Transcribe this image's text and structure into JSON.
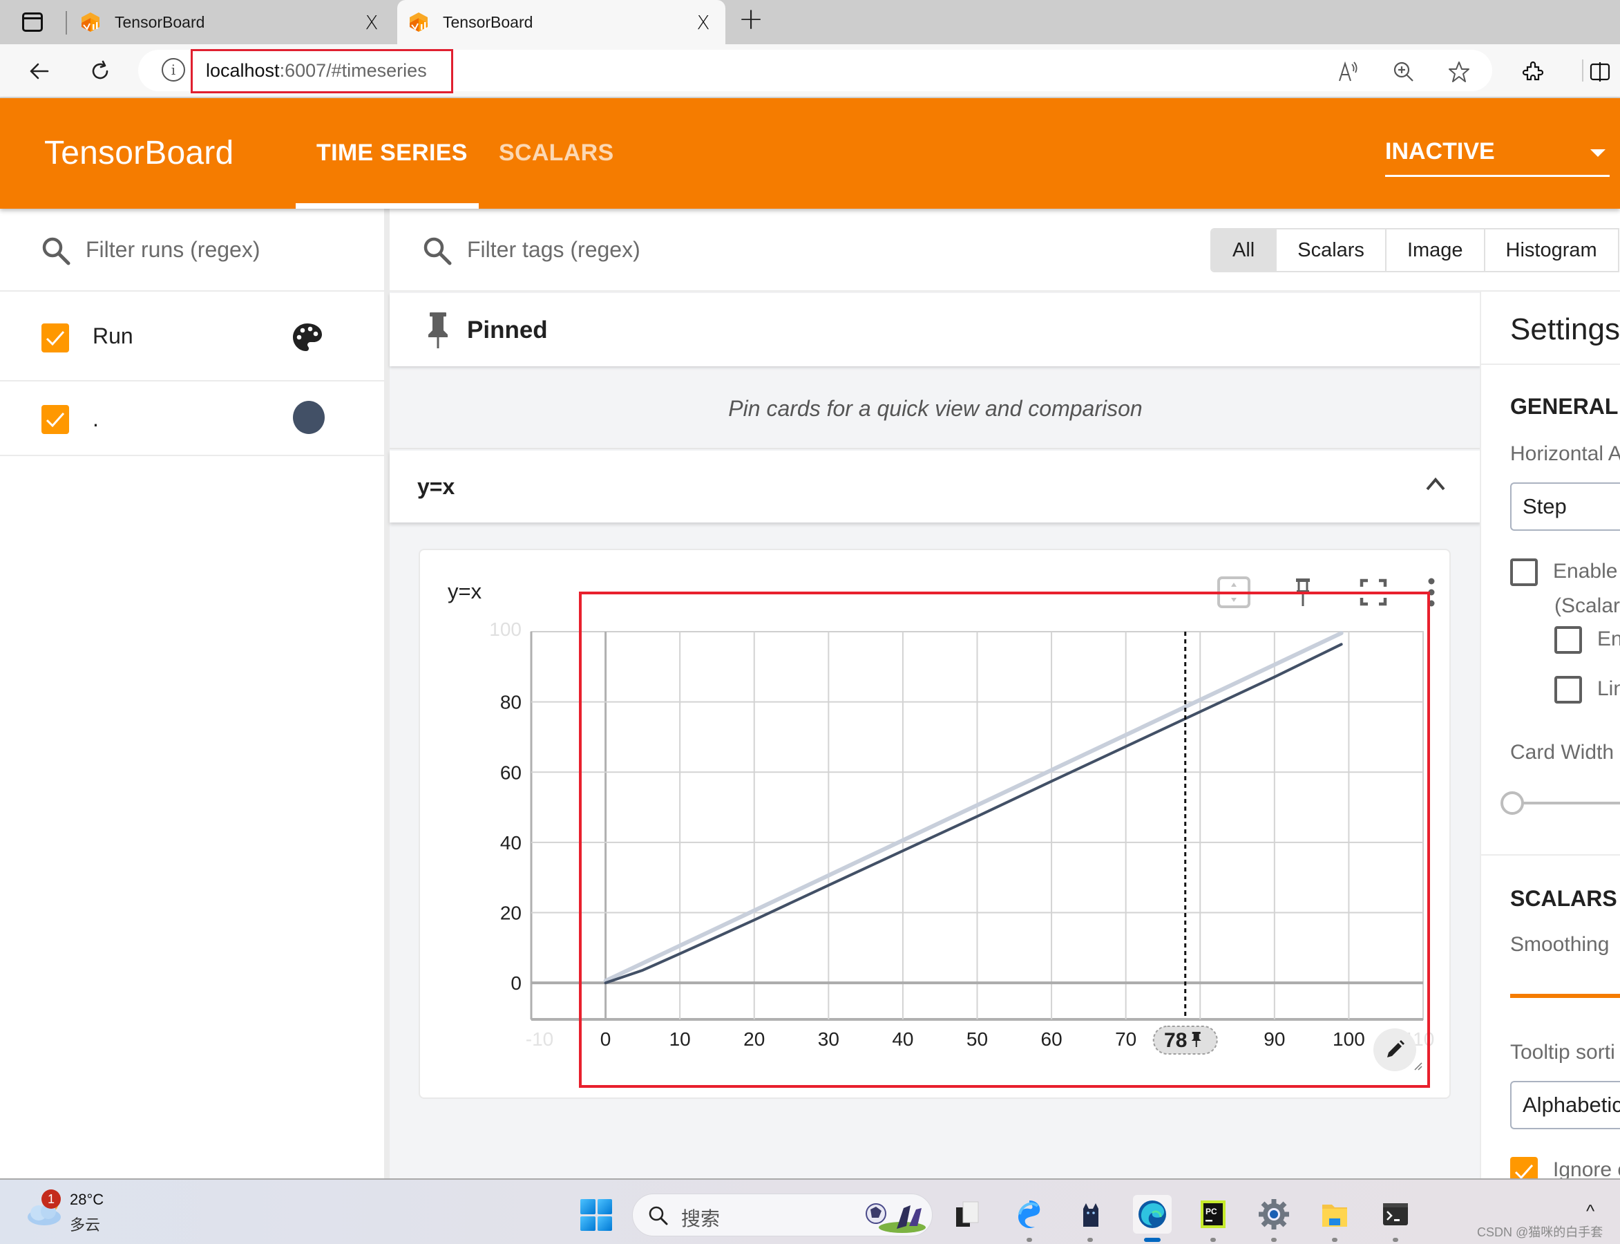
{
  "browser": {
    "tabs": [
      {
        "title": "TensorBoard",
        "active": false,
        "icon": "tensorboard-favicon"
      },
      {
        "title": "TensorBoard",
        "active": true,
        "icon": "tensorboard-favicon"
      }
    ],
    "tab_close_glyph": "X",
    "new_tab_glyph": "+",
    "url_host": "localhost",
    "url_rest": ":6007/#timeseries",
    "toolbar_icons": [
      "read-aloud-icon",
      "zoom-icon",
      "favorite-star-icon",
      "extensions-icon",
      "split-screen-icon"
    ]
  },
  "header": {
    "logo": "TensorBoard",
    "tabs": [
      {
        "label": "TIME SERIES",
        "active": true
      },
      {
        "label": "SCALARS",
        "active": false
      }
    ],
    "status_select": "INACTIVE",
    "colors": {
      "brand": "#f57c00",
      "checkbox": "#ff9800",
      "run_color": "#425066",
      "smoothed_raw": "#c8cfdb"
    }
  },
  "runs": {
    "filter_placeholder": "Filter runs (regex)",
    "header_row": {
      "label": "Run",
      "checked": true
    },
    "items": [
      {
        "label": ".",
        "checked": true,
        "color": "#425066"
      }
    ]
  },
  "main": {
    "tag_filter_placeholder": "Filter tags (regex)",
    "type_filters": [
      "All",
      "Scalars",
      "Image",
      "Histogram"
    ],
    "type_filter_selected": "All",
    "pinned_title": "Pinned",
    "pinned_empty": "Pin cards for a quick view and comparison",
    "group_title": "y=x",
    "card": {
      "title": "y=x",
      "toolbar": [
        "fit-domain-icon",
        "pin-icon",
        "fullscreen-icon",
        "more-vert-icon"
      ],
      "pinned_step_label": "78"
    }
  },
  "chart_data": {
    "type": "line",
    "title": "y=x",
    "xlabel": "",
    "ylabel": "",
    "xlim": [
      -10,
      110
    ],
    "ylim": [
      -10.4,
      100
    ],
    "x_ticks": [
      0,
      10,
      20,
      30,
      40,
      50,
      60,
      70,
      90,
      100
    ],
    "x_ticks_faded": [
      -10,
      110
    ],
    "y_ticks": [
      0,
      20,
      40,
      60,
      80
    ],
    "y_ticks_faded": [
      100
    ],
    "grid": true,
    "legend": "none",
    "pinned_step": 78,
    "series": [
      {
        "name": ". (raw)",
        "color": "#c8cfdb",
        "x": [
          0,
          99
        ],
        "y": [
          0,
          99
        ]
      },
      {
        "name": ". (smoothed)",
        "color": "#425066",
        "x": [
          0,
          5,
          10,
          20,
          30,
          40,
          50,
          60,
          70,
          80,
          90,
          99
        ],
        "y": [
          0,
          3.6,
          8.3,
          17.9,
          27.8,
          37.6,
          47.4,
          57.4,
          67.3,
          77.2,
          87.1,
          96.4
        ]
      }
    ]
  },
  "settings": {
    "title": "Settings",
    "general_heading": "GENERAL",
    "horizontal_axis_label": "Horizontal A",
    "horizontal_axis_value": "Step",
    "enable_step_selection_label": "Enable s",
    "enable_step_selection_sub": "(Scalars",
    "enable_range_label": "Ena",
    "link_label": "Lin",
    "enable_checked": false,
    "card_width_label": "Card Width",
    "card_width_value": 0,
    "scalars_heading": "SCALARS",
    "smoothing_label": "Smoothing",
    "tooltip_sort_label": "Tooltip sorti",
    "tooltip_sort_value": "Alphabetic",
    "ignore_outliers_label": "Ignore o",
    "ignore_outliers_checked": true
  },
  "taskbar": {
    "weather_badge": "1",
    "weather_temp": "28°C",
    "weather_desc": "多云",
    "search_placeholder": "搜索",
    "apps": [
      "file-manager-icon",
      "edge-beta-icon",
      "cat-app-icon",
      "edge-icon",
      "pycharm-icon",
      "settings-icon",
      "file-explorer-icon",
      "terminal-icon"
    ],
    "active_app": "edge-icon",
    "tray_chevron": "^",
    "watermark": "CSDN @猫咪的白手套"
  }
}
